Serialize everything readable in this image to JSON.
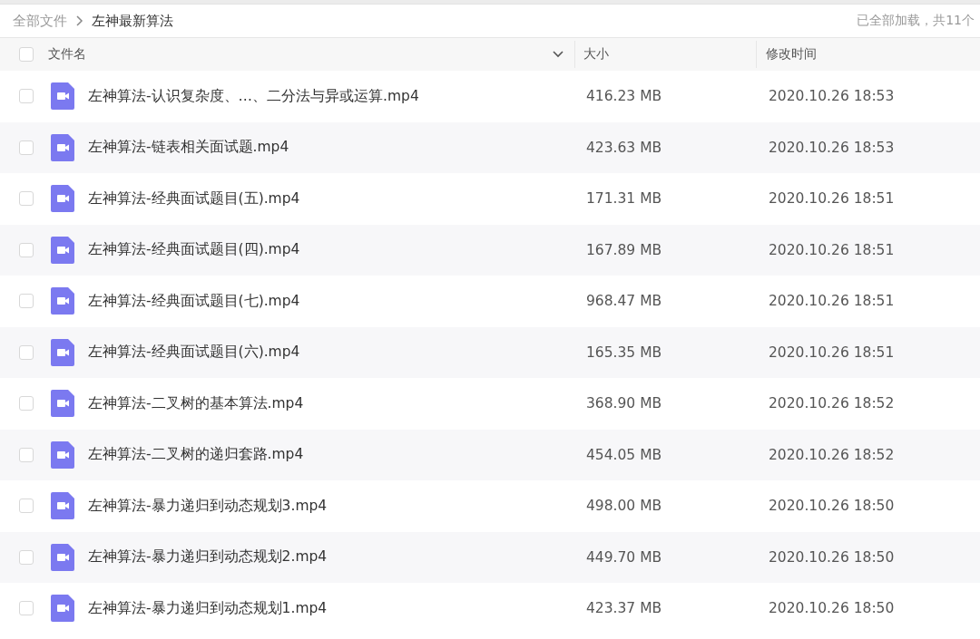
{
  "breadcrumb": {
    "items": [
      "全部文件",
      "左神最新算法"
    ],
    "status": "已全部加载，共11个"
  },
  "table": {
    "select_all": {
      "checked": false
    },
    "columns": [
      "文件名",
      "大小",
      "修改时间"
    ],
    "rows": [
      {
        "checked": false,
        "name": "左神算法-认识复杂度、…、二分法与异或运算.mp4",
        "size": "416.23 MB",
        "modified": "2020.10.26 18:53"
      },
      {
        "checked": false,
        "name": "左神算法-链表相关面试题.mp4",
        "size": "423.63 MB",
        "modified": "2020.10.26 18:53"
      },
      {
        "checked": false,
        "name": "左神算法-经典面试题目(五).mp4",
        "size": "171.31 MB",
        "modified": "2020.10.26 18:51"
      },
      {
        "checked": false,
        "name": "左神算法-经典面试题目(四).mp4",
        "size": "167.89 MB",
        "modified": "2020.10.26 18:51"
      },
      {
        "checked": false,
        "name": "左神算法-经典面试题目(七).mp4",
        "size": "968.47 MB",
        "modified": "2020.10.26 18:51"
      },
      {
        "checked": false,
        "name": "左神算法-经典面试题目(六).mp4",
        "size": "165.35 MB",
        "modified": "2020.10.26 18:51"
      },
      {
        "checked": false,
        "name": "左神算法-二叉树的基本算法.mp4",
        "size": "368.90 MB",
        "modified": "2020.10.26 18:52"
      },
      {
        "checked": false,
        "name": "左神算法-二叉树的递归套路.mp4",
        "size": "454.05 MB",
        "modified": "2020.10.26 18:52"
      },
      {
        "checked": false,
        "name": "左神算法-暴力递归到动态规划3.mp4",
        "size": "498.00 MB",
        "modified": "2020.10.26 18:50"
      },
      {
        "checked": false,
        "name": "左神算法-暴力递归到动态规划2.mp4",
        "size": "449.70 MB",
        "modified": "2020.10.26 18:50"
      },
      {
        "checked": false,
        "name": "左神算法-暴力递归到动态规划1.mp4",
        "size": "423.37 MB",
        "modified": "2020.10.26 18:50"
      }
    ]
  }
}
